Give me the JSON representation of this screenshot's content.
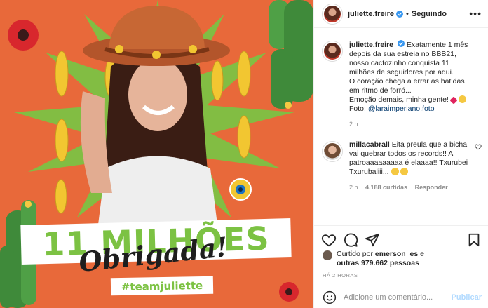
{
  "post": {
    "headline": "11 MILHÕES",
    "thanks": "Obrigada!",
    "hashtag": "#teamjuliette"
  },
  "header": {
    "username": "juliette.freire",
    "separator": "•",
    "follow_status": "Seguindo",
    "more_icon": "more-horizontal-icon"
  },
  "caption": {
    "username": "juliette.freire",
    "text_1": "Exatamente 1 mês depois da sua estreia no BBB21, nosso cactozinho conquista 11 milhões de seguidores por aqui.",
    "text_2": "O coração chega a errar as batidas em ritmo de forró...",
    "text_3": "Emoção demais, minha gente!",
    "photo_prefix": "Foto:",
    "photo_credit": "@laraimperiano.foto",
    "age": "2 h"
  },
  "comment": {
    "username": "millacabrall",
    "text": "Eita preula que a bicha vai quebrar todos os records!! A patroaaaaaaaaa é elaaaa!! Txurubei Txurubaliii...",
    "age": "2 h",
    "likes": "4.188 curtidas",
    "reply": "Responder"
  },
  "likes": {
    "prefix": "Curtido por",
    "user": "emerson_es",
    "middle": "e",
    "others": "outras 979.662 pessoas"
  },
  "timestamp": "HÁ 2 HORAS",
  "add_comment": {
    "placeholder": "Adicione um comentário...",
    "publish": "Publicar"
  },
  "colors": {
    "background_orange": "#e8693a",
    "accent_green": "#7cc243",
    "link_blue": "#00376b",
    "verified_blue": "#3897f0"
  }
}
